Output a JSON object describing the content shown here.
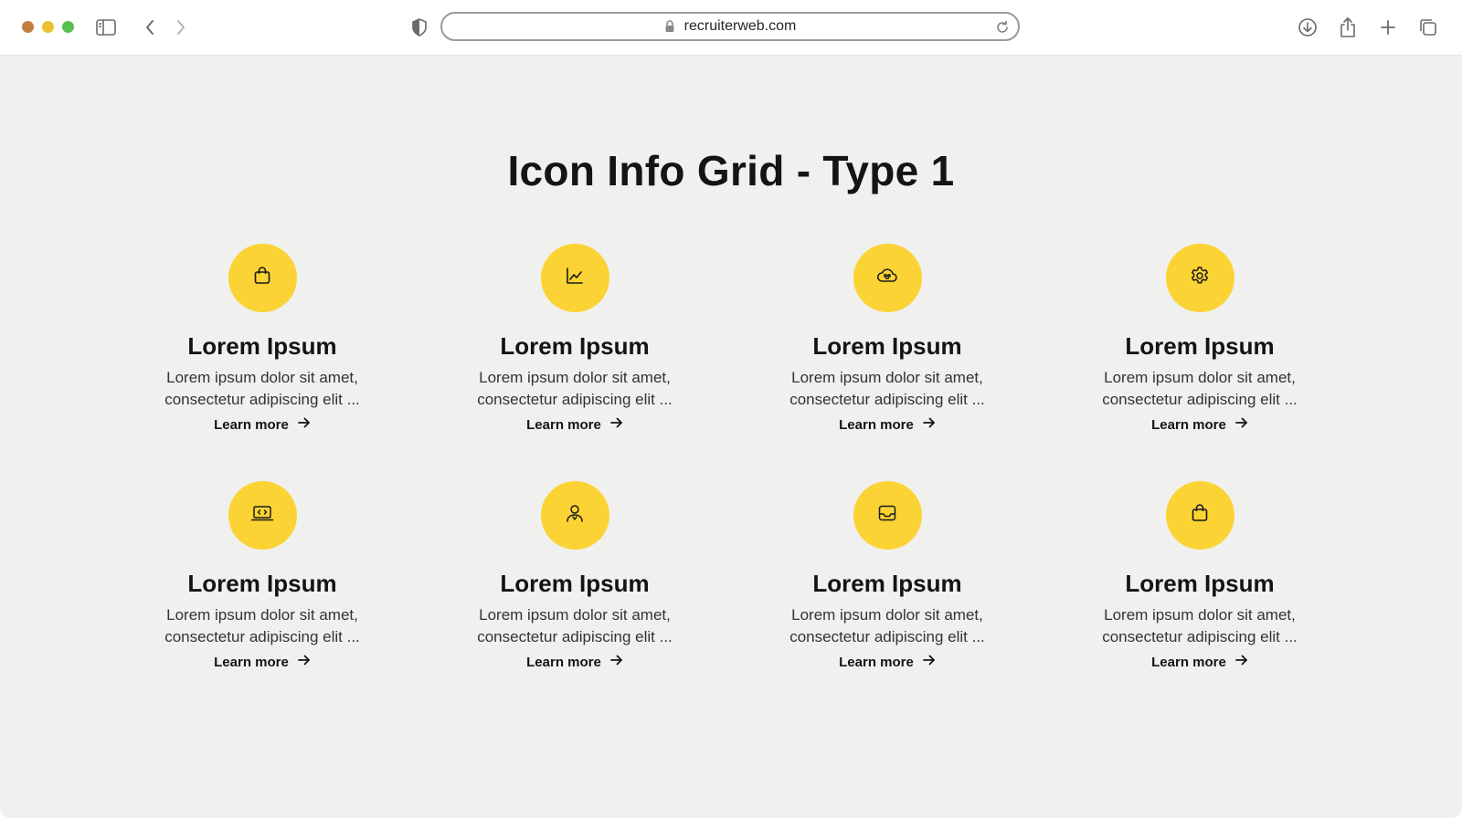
{
  "browser": {
    "url": "recruiterweb.com"
  },
  "page": {
    "title": "Icon Info Grid - Type 1"
  },
  "cards": [
    {
      "icon": "shopping-bag-icon",
      "title": "Lorem Ipsum",
      "desc": "Lorem ipsum dolor sit amet, consectetur adipiscing elit ...",
      "link": "Learn more"
    },
    {
      "icon": "line-chart-icon",
      "title": "Lorem Ipsum",
      "desc": "Lorem ipsum dolor sit amet, consectetur adipiscing elit ...",
      "link": "Learn more"
    },
    {
      "icon": "cloud-code-icon",
      "title": "Lorem Ipsum",
      "desc": "Lorem ipsum dolor sit amet, consectetur adipiscing elit ...",
      "link": "Learn more"
    },
    {
      "icon": "gear-icon",
      "title": "Lorem Ipsum",
      "desc": "Lorem ipsum dolor sit amet, consectetur adipiscing elit ...",
      "link": "Learn more"
    },
    {
      "icon": "laptop-code-icon",
      "title": "Lorem Ipsum",
      "desc": "Lorem ipsum dolor sit amet, consectetur adipiscing elit ...",
      "link": "Learn more"
    },
    {
      "icon": "user-badge-icon",
      "title": "Lorem Ipsum",
      "desc": "Lorem ipsum dolor sit amet, consectetur adipiscing elit ...",
      "link": "Learn more"
    },
    {
      "icon": "inbox-tray-icon",
      "title": "Lorem Ipsum",
      "desc": "Lorem ipsum dolor sit amet, consectetur adipiscing elit ...",
      "link": "Learn more"
    },
    {
      "icon": "shopping-bag-icon",
      "title": "Lorem Ipsum",
      "desc": "Lorem ipsum dolor sit amet, consectetur adipiscing elit ...",
      "link": "Learn more"
    }
  ],
  "colors": {
    "accent": "#fbd334",
    "background": "#f0f0ee",
    "text": "#141414"
  }
}
